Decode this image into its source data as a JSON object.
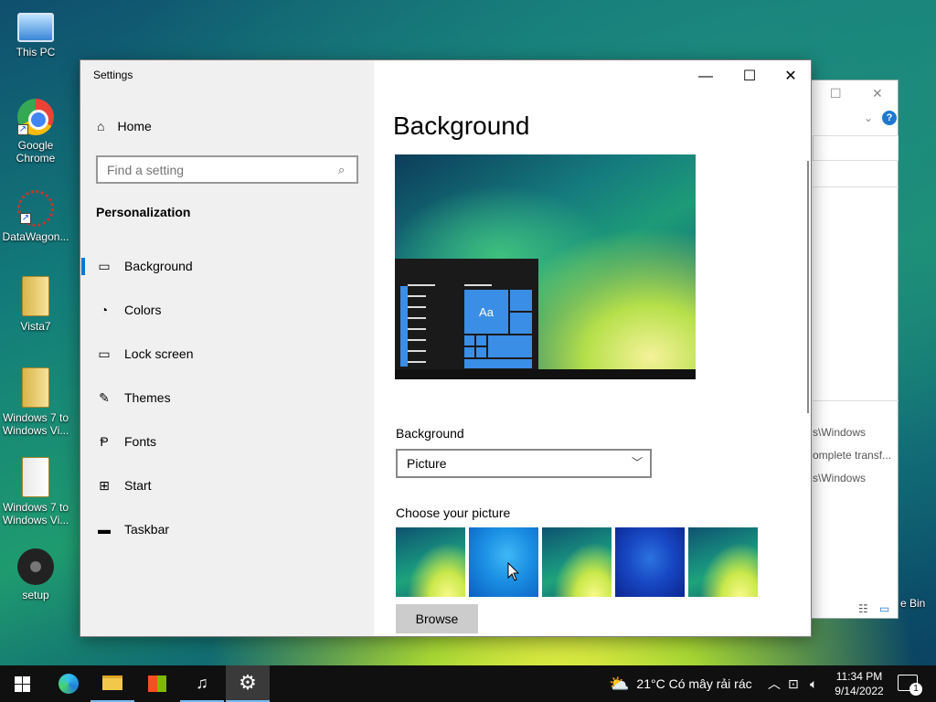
{
  "desktop": {
    "icons": [
      {
        "label": "This PC"
      },
      {
        "label": "Google\nChrome"
      },
      {
        "label": "DataWagon..."
      },
      {
        "label": "Vista7"
      },
      {
        "label": "Windows 7 to\nWindows Vi..."
      },
      {
        "label": "Windows 7 to\nWindows Vi..."
      },
      {
        "label": "setup"
      }
    ],
    "recycle_bin_partial": "e Bin"
  },
  "explorer_bg": {
    "paths": [
      "s\\Windows",
      "omplete transf...",
      "s\\Windows"
    ]
  },
  "settings": {
    "window_title": "Settings",
    "home_label": "Home",
    "search_placeholder": "Find a setting",
    "section": "Personalization",
    "nav": [
      {
        "label": "Background",
        "icon": "image-icon",
        "active": true
      },
      {
        "label": "Colors",
        "icon": "palette-icon"
      },
      {
        "label": "Lock screen",
        "icon": "lock-screen-icon"
      },
      {
        "label": "Themes",
        "icon": "themes-icon"
      },
      {
        "label": "Fonts",
        "icon": "fonts-icon"
      },
      {
        "label": "Start",
        "icon": "start-icon"
      },
      {
        "label": "Taskbar",
        "icon": "taskbar-icon"
      }
    ],
    "page_title": "Background",
    "preview_tile_text": "Aa",
    "background_label": "Background",
    "background_value": "Picture",
    "choose_label": "Choose your picture",
    "browse_label": "Browse"
  },
  "taskbar": {
    "weather": "21°C  Có mây rải rác",
    "time": "11:34 PM",
    "date": "9/14/2022",
    "notification_count": "1"
  }
}
